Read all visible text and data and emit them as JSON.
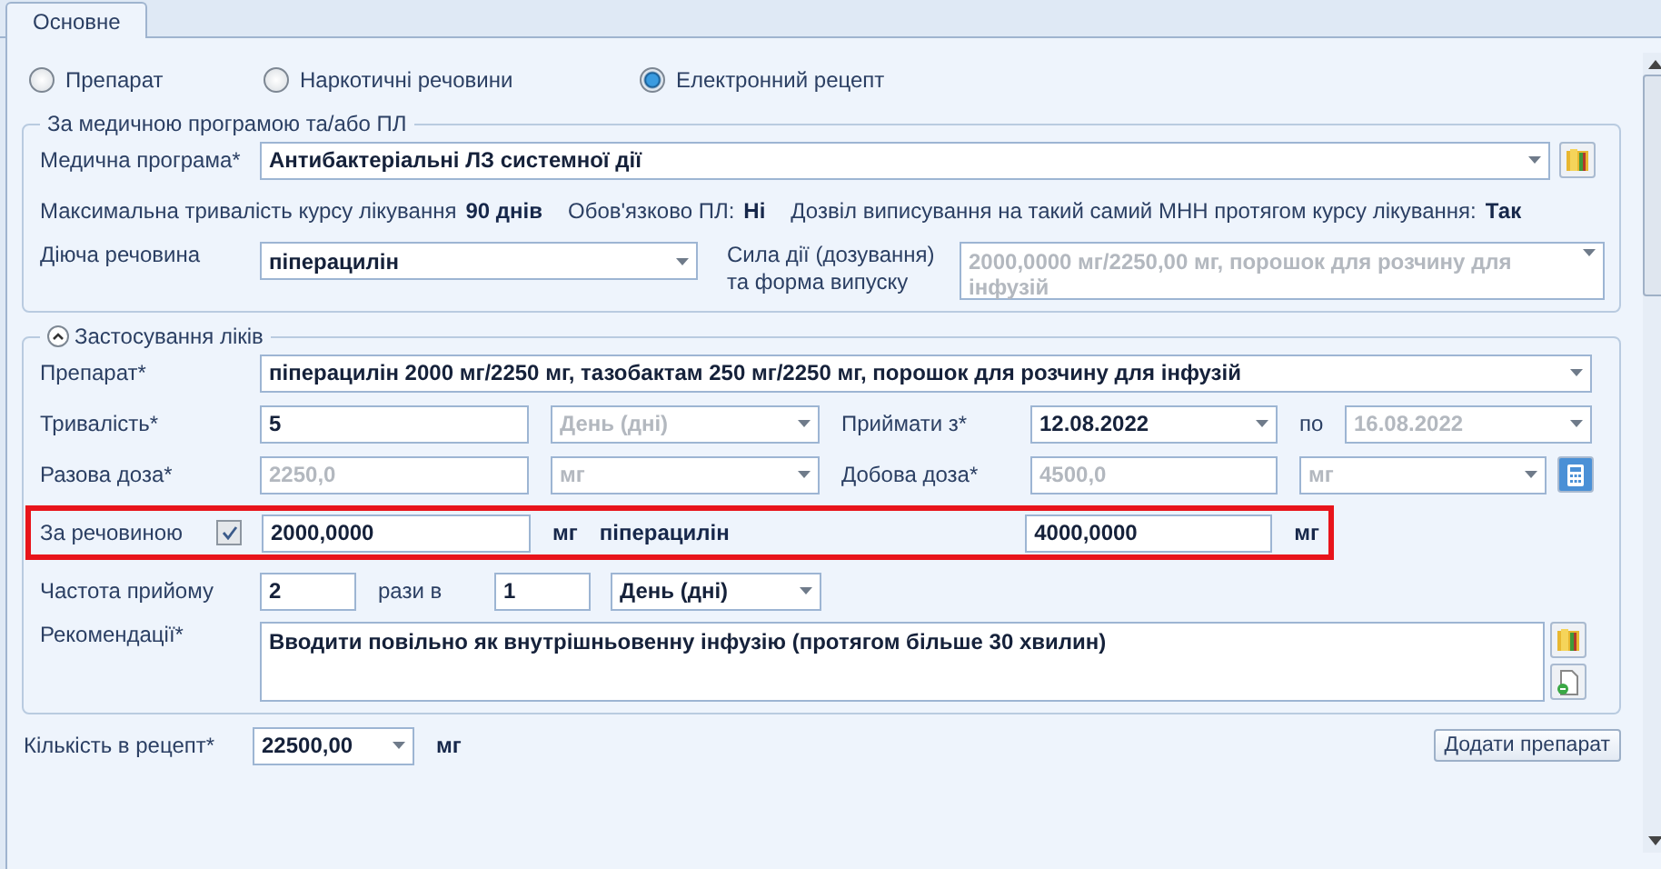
{
  "tabs": [
    {
      "label": "Основне",
      "selected": true
    }
  ],
  "mode_options": [
    {
      "label": "Препарат",
      "selected": false
    },
    {
      "label": "Наркотичні речовини",
      "selected": false
    },
    {
      "label": "Електронний рецепт",
      "selected": true
    }
  ],
  "program_group": {
    "title": "За медичною програмою та/або ПЛ",
    "program": {
      "label": "Медична програма*",
      "value": "Антибактеріальні ЛЗ системної дії",
      "kind": "dropdown",
      "disabled": false
    },
    "info": [
      {
        "label": "Максимальна тривалість курсу лікування",
        "value": "90 днів"
      },
      {
        "label": "Обов'язково ПЛ:",
        "value": "Ні"
      },
      {
        "label": "Дозвіл виписування на такий самий МНН протягом курсу лікування:",
        "value": "Так"
      }
    ],
    "substance": {
      "label": "Діюча речовина",
      "value": "піперацилін",
      "kind": "dropdown",
      "disabled": false
    },
    "strength": {
      "label": "Сила дії (дозування) та форма випуску",
      "value": "2000,0000 мг/2250,00 мг, порошок для розчину для інфузій",
      "kind": "dropdown",
      "disabled": true
    }
  },
  "usage_group": {
    "title": "Застосування ліків",
    "expanded": true,
    "drug": {
      "label": "Препарат*",
      "value": "піперацилін 2000 мг/2250 мг, тазобактам 250 мг/2250 мг, порошок для розчину для інфузій",
      "kind": "dropdown",
      "disabled": false
    },
    "duration": {
      "label": "Тривалість*",
      "value": "5",
      "disabled": false
    },
    "duration_unit": {
      "value": "День (дні)",
      "kind": "dropdown",
      "disabled": true
    },
    "start": {
      "label": "Приймати з*",
      "value": "12.08.2022",
      "kind": "dropdown",
      "disabled": false
    },
    "end": {
      "label": "по",
      "value": "16.08.2022",
      "kind": "dropdown",
      "disabled": true
    },
    "single_dose": {
      "label": "Разова доза*",
      "value": "2250,0",
      "disabled": true
    },
    "single_dose_unit": {
      "value": "мг",
      "kind": "dropdown",
      "disabled": true
    },
    "daily_dose": {
      "label": "Добова доза*",
      "value": "4500,0",
      "disabled": true
    },
    "daily_dose_unit": {
      "value": "мг",
      "kind": "dropdown",
      "disabled": true
    },
    "by_substance": {
      "label": "За речовиною",
      "checked": true,
      "value": "2000,0000",
      "unit": "мг",
      "substance": "піперацилін",
      "total": "4000,0000",
      "total_unit": "мг"
    },
    "frequency": {
      "label": "Частота прийому",
      "times": "2",
      "between": "рази в",
      "count": "1",
      "period": "День (дні)"
    },
    "recommendations": {
      "label": "Рекомендації*",
      "value": "Вводити повільно як внутрішньовенну інфузію (протягом більше 30 хвилин)"
    }
  },
  "quantity": {
    "label": "Кількість в рецепт*",
    "value": "22500,00",
    "unit": "мг"
  },
  "add_button": "Додати препарат"
}
